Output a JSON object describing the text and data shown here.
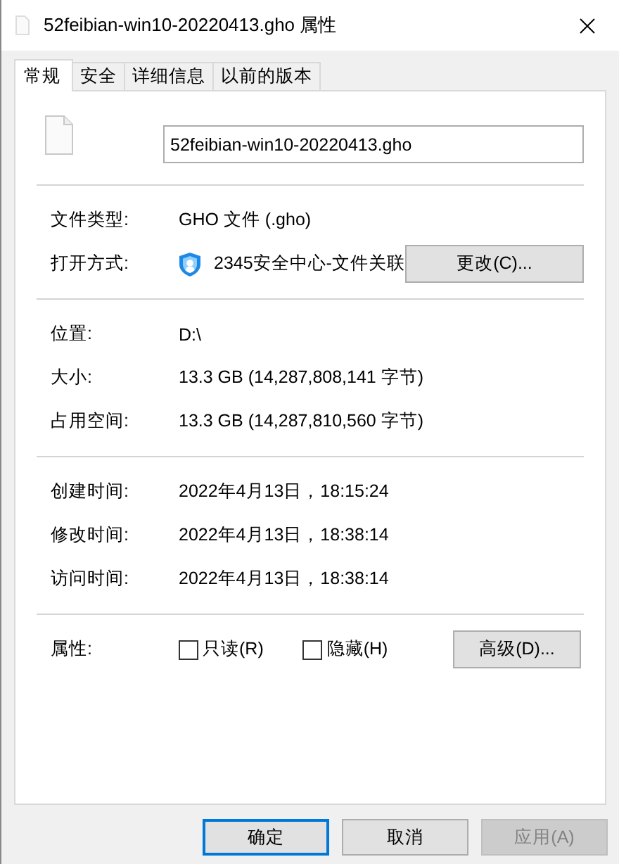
{
  "window": {
    "title": "52feibian-win10-20220413.gho 属性"
  },
  "tabs": [
    {
      "label": "常规",
      "selected": true
    },
    {
      "label": "安全",
      "selected": false
    },
    {
      "label": "详细信息",
      "selected": false
    },
    {
      "label": "以前的版本",
      "selected": false
    }
  ],
  "file_name": "52feibian-win10-20220413.gho",
  "sections": [
    {
      "rows": [
        {
          "kind": "text",
          "label": "文件类型:",
          "value": "GHO 文件 (.gho)"
        },
        {
          "kind": "app",
          "label": "打开方式:",
          "value": "2345安全中心-文件关联",
          "button": "更改(C)..."
        }
      ]
    },
    {
      "rows": [
        {
          "kind": "text",
          "label": "位置:",
          "value": "D:\\"
        },
        {
          "kind": "text",
          "label": "大小:",
          "value": "13.3 GB (14,287,808,141 字节)"
        },
        {
          "kind": "text",
          "label": "占用空间:",
          "value": "13.3 GB (14,287,810,560 字节)"
        }
      ]
    },
    {
      "rows": [
        {
          "kind": "text",
          "label": "创建时间:",
          "value": "2022年4月13日，18:15:24"
        },
        {
          "kind": "text",
          "label": "修改时间:",
          "value": "2022年4月13日，18:38:14"
        },
        {
          "kind": "text",
          "label": "访问时间:",
          "value": "2022年4月13日，18:38:14"
        }
      ]
    },
    {
      "rows": [
        {
          "kind": "attributes",
          "label": "属性:",
          "checkboxes": [
            {
              "label": "只读(R)",
              "checked": false
            },
            {
              "label": "隐藏(H)",
              "checked": false
            }
          ],
          "button": "高级(D)..."
        }
      ]
    }
  ],
  "buttons": [
    {
      "label": "确定",
      "default": true,
      "disabled": false
    },
    {
      "label": "取消",
      "default": false,
      "disabled": false
    },
    {
      "label": "应用(A)",
      "default": false,
      "disabled": true
    }
  ]
}
